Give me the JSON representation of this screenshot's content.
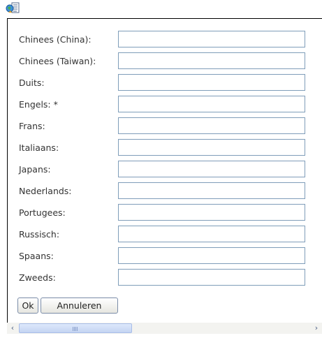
{
  "toolbar": {
    "icon": "edit-translations-icon"
  },
  "form": {
    "fields": [
      {
        "label": "Chinees (China):",
        "value": ""
      },
      {
        "label": "Chinees (Taiwan):",
        "value": ""
      },
      {
        "label": "Duits:",
        "value": ""
      },
      {
        "label": "Engels: *",
        "value": ""
      },
      {
        "label": "Frans:",
        "value": ""
      },
      {
        "label": "Italiaans:",
        "value": ""
      },
      {
        "label": "Japans:",
        "value": ""
      },
      {
        "label": "Nederlands:",
        "value": ""
      },
      {
        "label": "Portugees:",
        "value": ""
      },
      {
        "label": "Russisch:",
        "value": ""
      },
      {
        "label": "Spaans:",
        "value": ""
      },
      {
        "label": "Zweeds:",
        "value": ""
      }
    ],
    "ok_label": "Ok",
    "cancel_label": "Annuleren"
  },
  "scrollbar": {
    "left_arrow": "‹",
    "right_arrow": "›"
  },
  "colors": {
    "input_border": "#7f9db9",
    "label_text": "#333333",
    "scroll_thumb": "#c4d4f2"
  }
}
